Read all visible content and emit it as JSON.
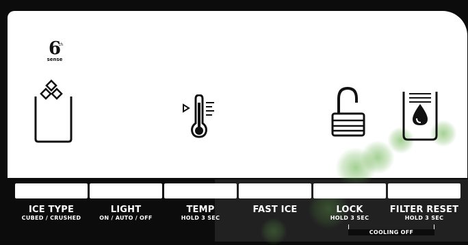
{
  "brand": {
    "sixth_number": "6",
    "sixth_suffix": "th",
    "sixth_word": "sense"
  },
  "icons": {
    "ice": "ice-bucket-icon",
    "temp": "thermometer-icon",
    "lock": "padlock-open-icon",
    "filter": "water-filter-icon"
  },
  "buttons": [
    {
      "id": "ice-type",
      "label": "ICE TYPE",
      "sub": "CUBED / CRUSHED"
    },
    {
      "id": "light",
      "label": "LIGHT",
      "sub": "ON / AUTO / OFF"
    },
    {
      "id": "temp",
      "label": "TEMP",
      "sub": "HOLD 3 SEC"
    },
    {
      "id": "fast-ice",
      "label": "FAST ICE",
      "sub": ""
    },
    {
      "id": "lock",
      "label": "LOCK",
      "sub": "HOLD 3 SEC"
    },
    {
      "id": "filter-reset",
      "label": "FILTER RESET",
      "sub": "HOLD 3 SEC"
    }
  ],
  "cooling_off": "COOLING OFF",
  "colors": {
    "panel": "#0c0c0c",
    "display": "#ffffff",
    "glow": "#5aaa3c"
  }
}
